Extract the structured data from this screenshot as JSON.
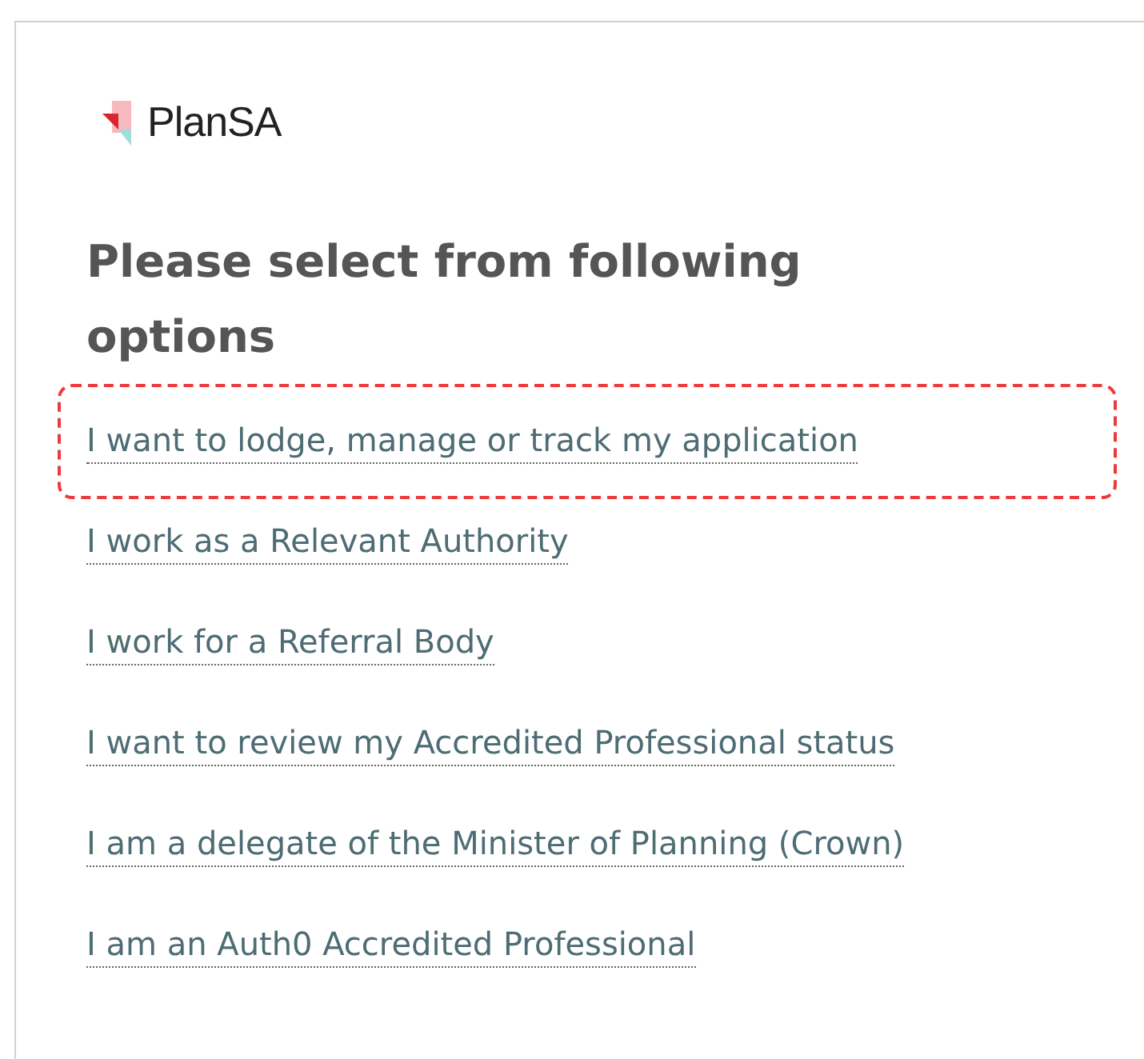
{
  "logo": {
    "text": "PlanSA"
  },
  "heading": "Please select from following options",
  "options": [
    {
      "label": "I want to lodge, manage or track my application",
      "highlighted": true
    },
    {
      "label": "I work as a Relevant Authority",
      "highlighted": false
    },
    {
      "label": "I work for a Referral Body",
      "highlighted": false
    },
    {
      "label": "I want to review my Accredited Professional status",
      "highlighted": false
    },
    {
      "label": "I am a delegate of the Minister of Planning (Crown)",
      "highlighted": false
    },
    {
      "label": "I am an Auth0 Accredited Professional",
      "highlighted": false
    }
  ]
}
